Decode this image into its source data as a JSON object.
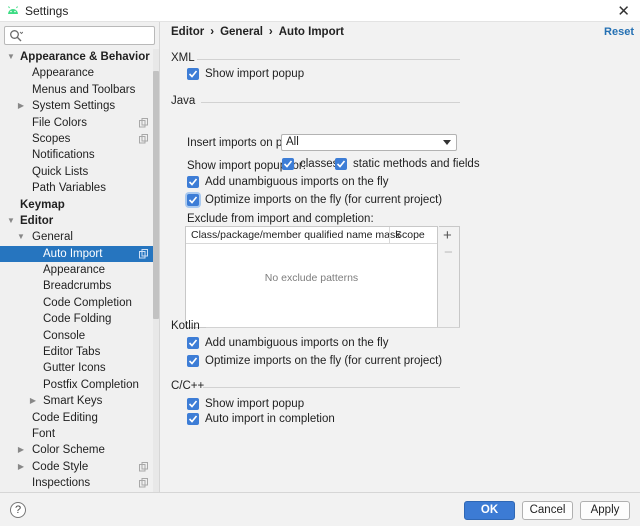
{
  "window": {
    "title": "Settings",
    "close_glyph": "✕",
    "icon": "android-icon"
  },
  "search": {
    "placeholder": "",
    "value": ""
  },
  "sidebar": {
    "items": [
      {
        "label": "Appearance & Behavior",
        "level": 0,
        "arrow": "down",
        "bold": true,
        "copy": false,
        "selected": false
      },
      {
        "label": "Appearance",
        "level": 1,
        "arrow": "",
        "bold": false,
        "copy": false,
        "selected": false
      },
      {
        "label": "Menus and Toolbars",
        "level": 1,
        "arrow": "",
        "bold": false,
        "copy": false,
        "selected": false
      },
      {
        "label": "System Settings",
        "level": 1,
        "arrow": "right",
        "bold": false,
        "copy": false,
        "selected": false
      },
      {
        "label": "File Colors",
        "level": 1,
        "arrow": "",
        "bold": false,
        "copy": true,
        "selected": false
      },
      {
        "label": "Scopes",
        "level": 1,
        "arrow": "",
        "bold": false,
        "copy": true,
        "selected": false
      },
      {
        "label": "Notifications",
        "level": 1,
        "arrow": "",
        "bold": false,
        "copy": false,
        "selected": false
      },
      {
        "label": "Quick Lists",
        "level": 1,
        "arrow": "",
        "bold": false,
        "copy": false,
        "selected": false
      },
      {
        "label": "Path Variables",
        "level": 1,
        "arrow": "",
        "bold": false,
        "copy": false,
        "selected": false
      },
      {
        "label": "Keymap",
        "level": 0,
        "arrow": "",
        "bold": true,
        "copy": false,
        "selected": false
      },
      {
        "label": "Editor",
        "level": 0,
        "arrow": "down",
        "bold": true,
        "copy": false,
        "selected": false
      },
      {
        "label": "General",
        "level": 1,
        "arrow": "down",
        "bold": false,
        "copy": false,
        "selected": false
      },
      {
        "label": "Auto Import",
        "level": 2,
        "arrow": "",
        "bold": false,
        "copy": true,
        "selected": true
      },
      {
        "label": "Appearance",
        "level": 2,
        "arrow": "",
        "bold": false,
        "copy": false,
        "selected": false
      },
      {
        "label": "Breadcrumbs",
        "level": 2,
        "arrow": "",
        "bold": false,
        "copy": false,
        "selected": false
      },
      {
        "label": "Code Completion",
        "level": 2,
        "arrow": "",
        "bold": false,
        "copy": false,
        "selected": false
      },
      {
        "label": "Code Folding",
        "level": 2,
        "arrow": "",
        "bold": false,
        "copy": false,
        "selected": false
      },
      {
        "label": "Console",
        "level": 2,
        "arrow": "",
        "bold": false,
        "copy": false,
        "selected": false
      },
      {
        "label": "Editor Tabs",
        "level": 2,
        "arrow": "",
        "bold": false,
        "copy": false,
        "selected": false
      },
      {
        "label": "Gutter Icons",
        "level": 2,
        "arrow": "",
        "bold": false,
        "copy": false,
        "selected": false
      },
      {
        "label": "Postfix Completion",
        "level": 2,
        "arrow": "",
        "bold": false,
        "copy": false,
        "selected": false
      },
      {
        "label": "Smart Keys",
        "level": 2,
        "arrow": "right",
        "bold": false,
        "copy": false,
        "selected": false
      },
      {
        "label": "Code Editing",
        "level": 1,
        "arrow": "",
        "bold": false,
        "copy": false,
        "selected": false
      },
      {
        "label": "Font",
        "level": 1,
        "arrow": "",
        "bold": false,
        "copy": false,
        "selected": false
      },
      {
        "label": "Color Scheme",
        "level": 1,
        "arrow": "right",
        "bold": false,
        "copy": false,
        "selected": false
      },
      {
        "label": "Code Style",
        "level": 1,
        "arrow": "right",
        "bold": false,
        "copy": true,
        "selected": false
      },
      {
        "label": "Inspections",
        "level": 1,
        "arrow": "",
        "bold": false,
        "copy": true,
        "selected": false
      }
    ]
  },
  "breadcrumb": {
    "part1": "Editor",
    "part2": "General",
    "part3": "Auto Import",
    "sep": "›"
  },
  "reset_label": "Reset",
  "xml": {
    "title": "XML",
    "show_import_popup": {
      "label": "Show import popup",
      "checked": true
    }
  },
  "java": {
    "title": "Java",
    "insert_imports_label": "Insert imports on paste:",
    "insert_imports_value": "All",
    "show_popup_for_label": "Show import popup for:",
    "classes": {
      "label": "classes",
      "checked": true
    },
    "static_methods": {
      "label": "static methods and fields",
      "checked": true
    },
    "add_unambiguous": {
      "label": "Add unambiguous imports on the fly",
      "checked": true
    },
    "optimize_imports": {
      "label": "Optimize imports on the fly (for current project)",
      "checked": true
    },
    "exclude_label": "Exclude from import and completion:",
    "table": {
      "col1": "Class/package/member qualified name mask",
      "col2": "Scope",
      "empty_text": "No exclude patterns",
      "add_glyph": "+",
      "remove_glyph": "−"
    }
  },
  "kotlin": {
    "title": "Kotlin",
    "add_unambiguous": {
      "label": "Add unambiguous imports on the fly",
      "checked": true
    },
    "optimize_imports": {
      "label": "Optimize imports on the fly (for current project)",
      "checked": true
    }
  },
  "cpp": {
    "title": "C/C++",
    "show_import_popup": {
      "label": "Show import popup",
      "checked": true
    },
    "auto_import": {
      "label": "Auto import in completion",
      "checked": true
    }
  },
  "footer": {
    "help_glyph": "?",
    "ok": "OK",
    "cancel": "Cancel",
    "apply": "Apply"
  },
  "colors": {
    "accent": "#3c7bd4",
    "selection": "#2675bf",
    "link": "#2470b3"
  }
}
